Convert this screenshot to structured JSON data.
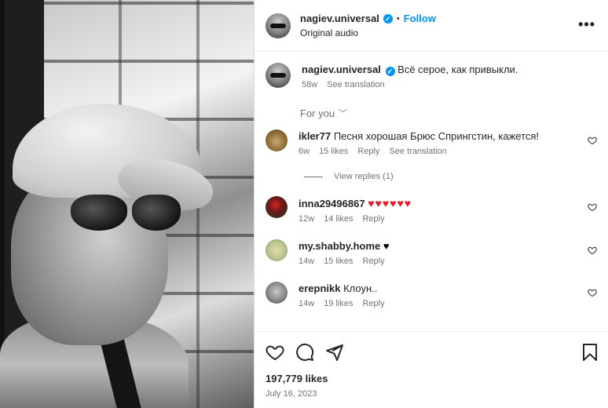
{
  "post": {
    "username": "nagiev.universal",
    "verified_icon": "verified-badge-icon",
    "separator": "•",
    "follow_label": "Follow",
    "audio": "Original audio",
    "more_label": "•••"
  },
  "caption": {
    "username": "nagiev.universal",
    "text": "Всё серое, как привыкли.",
    "age": "58w",
    "see_translation": "See translation"
  },
  "for_you": {
    "label": "For you",
    "chevron": "﹀"
  },
  "comments": [
    {
      "username": "ikler77",
      "text": "Песня хорошая Брюс Спрингстин, кажется!",
      "age": "6w",
      "likes": "15 likes",
      "reply": "Reply",
      "see_translation": "See translation"
    },
    {
      "username": "inna29496867",
      "text": "♥♥♥♥♥♥",
      "age": "12w",
      "likes": "14 likes",
      "reply": "Reply"
    },
    {
      "username": "my.shabby.home",
      "text": "♥",
      "age": "14w",
      "likes": "15 likes",
      "reply": "Reply"
    },
    {
      "username": "erepnikk",
      "text": "Клоун..",
      "age": "14w",
      "likes": "19 likes",
      "reply": "Reply"
    }
  ],
  "view_replies": "View replies (1)",
  "actions": {
    "likes": "197,779 likes",
    "date": "July 16, 2023",
    "icons": [
      "heart-icon",
      "comment-icon",
      "share-icon",
      "bookmark-icon"
    ]
  },
  "colors": {
    "accent": "#0095f6",
    "heart_red": "#ed1c24",
    "muted": "#737373"
  }
}
